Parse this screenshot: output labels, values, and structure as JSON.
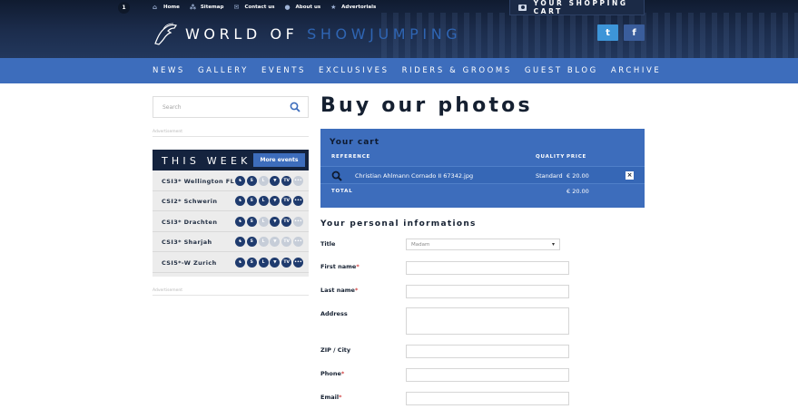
{
  "topnav": {
    "items": [
      {
        "label": "Home",
        "icon": "home-icon"
      },
      {
        "label": "Sitemap",
        "icon": "sitemap-icon"
      },
      {
        "label": "Contact us",
        "icon": "mail-icon"
      },
      {
        "label": "About us",
        "icon": "info-icon"
      },
      {
        "label": "Advertorials",
        "icon": "star-icon"
      }
    ]
  },
  "cart_widget": {
    "label": "YOUR SHOPPING CART",
    "count": "1"
  },
  "logo": {
    "word1": "WORLD OF",
    "word2": "SHOWJUMPING"
  },
  "social": {
    "twitter": "t",
    "facebook": "f"
  },
  "mainnav": {
    "items": [
      "NEWS",
      "GALLERY",
      "EVENTS",
      "EXCLUSIVES",
      "RIDERS & GROOMS",
      "GUEST BLOG",
      "ARCHIVE"
    ]
  },
  "search": {
    "placeholder": "Search"
  },
  "ads": {
    "label": "Advertisement"
  },
  "this_week": {
    "title": "THIS WEEK",
    "more_button": "More events",
    "events": [
      {
        "name": "CSI3* Wellington FL",
        "badges": [
          "on",
          "on",
          "off",
          "on",
          "on",
          "off"
        ]
      },
      {
        "name": "CSI2* Schwerin",
        "badges": [
          "on",
          "on",
          "on",
          "on",
          "on",
          "on"
        ]
      },
      {
        "name": "CSI3* Drachten",
        "badges": [
          "on",
          "on",
          "off",
          "on",
          "on",
          "off"
        ]
      },
      {
        "name": "CSI3* Sharjah",
        "badges": [
          "on",
          "on",
          "off",
          "off",
          "off",
          "off"
        ]
      },
      {
        "name": "CSI5*-W Zurich",
        "badges": [
          "on",
          "on",
          "on",
          "on",
          "on",
          "on"
        ]
      }
    ],
    "badge_labels": [
      "♞",
      "S",
      "L",
      "▼",
      "TV",
      "•••"
    ]
  },
  "page": {
    "title": "Buy our photos"
  },
  "cart": {
    "title": "Your cart",
    "col_reference": "REFERENCE",
    "col_quality": "QUALITY",
    "col_price": "PRICE",
    "item": {
      "file": "Christian Ahlmann Cornado II 67342.jpg",
      "quality": "Standard",
      "price": "€ 20.00"
    },
    "total_label": "TOTAL",
    "total_value": "€ 20.00"
  },
  "form": {
    "title": "Your personal informations",
    "title_label": "Title",
    "title_value": "Madam",
    "first_name": "First name",
    "last_name": "Last name",
    "address": "Address",
    "zip_city": "ZIP / City",
    "phone": "Phone",
    "email": "Email",
    "required_mark": "*"
  },
  "colors": {
    "header_dark": "#15233d",
    "nav_blue": "#3d6dbc",
    "twitter": "#3d95d8",
    "facebook": "#3a5d9c"
  }
}
